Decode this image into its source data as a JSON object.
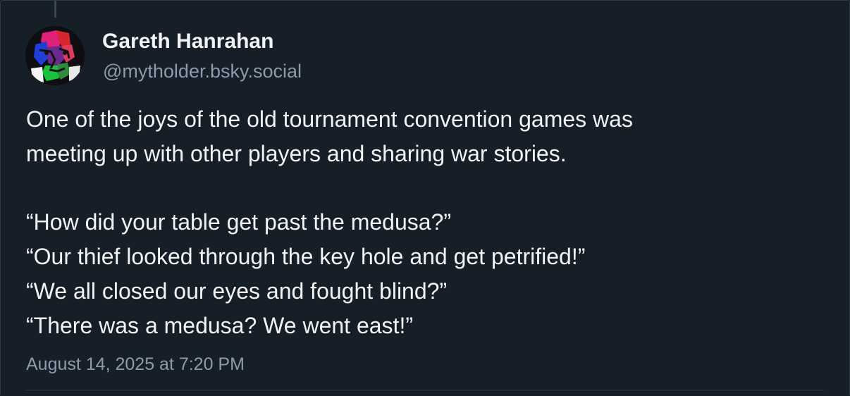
{
  "post": {
    "author": {
      "display_name": "Gareth Hanrahan",
      "handle": "@mytholder.bsky.social"
    },
    "text_lines": [
      "One of the joys of the old tournament convention games was",
      "meeting up with other players and sharing war stories.",
      "",
      "“How did your table get past the medusa?”",
      "“Our thief looked through the key hole and get petrified!”",
      "“We all closed our eyes and fought blind?”",
      "“There was a medusa? We went east!”"
    ],
    "timestamp": "August 14, 2025 at 7:20 PM"
  },
  "colors": {
    "background": "#161e27",
    "primary_text": "#f1f3f5",
    "secondary_text": "#8d9bab",
    "border": "#2e3a48"
  }
}
